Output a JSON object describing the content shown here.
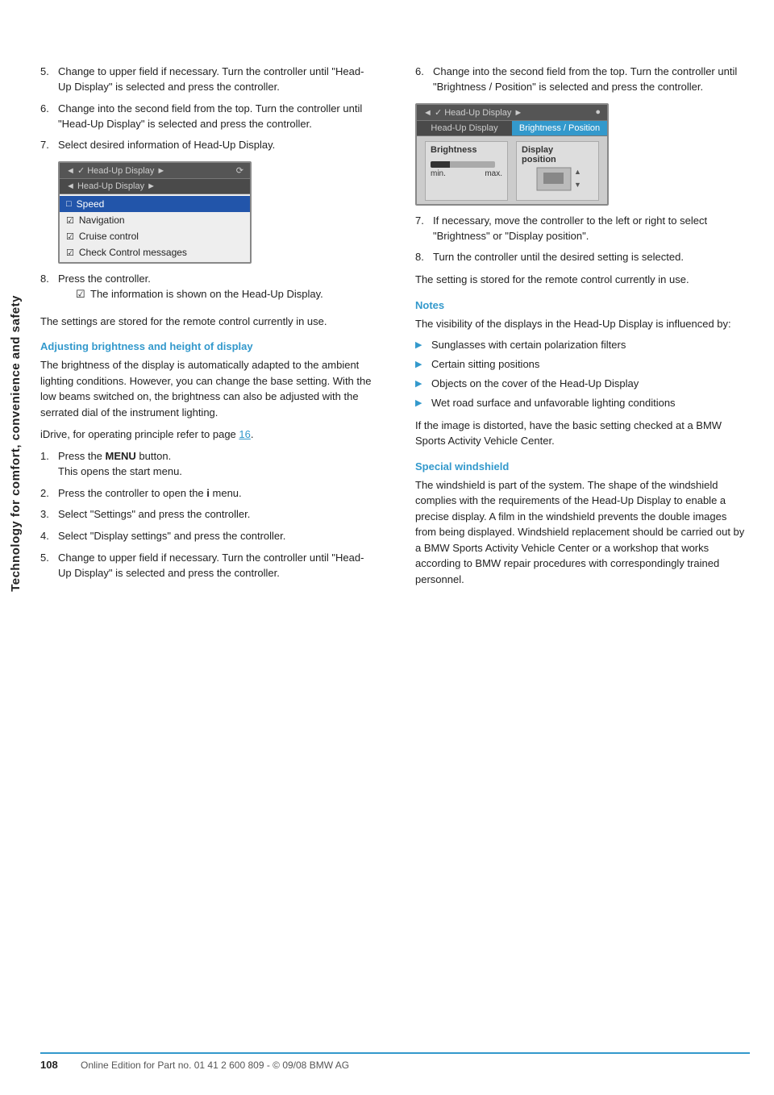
{
  "sidebar": {
    "label": "Technology for comfort, convenience and safety"
  },
  "left_col": {
    "steps_top": [
      {
        "num": "5.",
        "text": "Change to upper field if necessary. Turn the controller until \"Head-Up Display\" is selected and press the controller."
      },
      {
        "num": "6.",
        "text": "Change into the second field from the top. Turn the controller until \"Head-Up Display\" is selected and press the controller."
      },
      {
        "num": "7.",
        "text": "Select desired information of Head-Up Display."
      }
    ],
    "hud_ui_left": {
      "topbar_left": "◄ ✓ Head-Up Display ►",
      "navbar": "◄ Head-Up Display ►",
      "items": [
        {
          "icon": "□",
          "label": "Speed",
          "selected": true
        },
        {
          "icon": "☑",
          "label": "Navigation",
          "selected": false
        },
        {
          "icon": "☑",
          "label": "Cruise control",
          "selected": false
        },
        {
          "icon": "☑",
          "label": "Check Control messages",
          "selected": false
        }
      ]
    },
    "step8": {
      "num": "8.",
      "text": "Press the controller.",
      "substep": "The information is shown on the Head-Up Display."
    },
    "note_after_step8": "The settings are stored for the remote control currently in use.",
    "section_heading": "Adjusting brightness and height of display",
    "body1": "The brightness of the display is automatically adapted to the ambient lighting conditions. However, you can change the base setting. With the low beams switched on, the brightness can also be adjusted with the serrated dial of the instrument lighting.",
    "idrive_ref": "iDrive, for operating principle refer to page 16.",
    "steps_bottom": [
      {
        "num": "1.",
        "text": "Press the MENU button.\nThis opens the start menu."
      },
      {
        "num": "2.",
        "text": "Press the controller to open the i menu."
      },
      {
        "num": "3.",
        "text": "Select \"Settings\" and press the controller."
      },
      {
        "num": "4.",
        "text": "Select \"Display settings\" and press the controller."
      },
      {
        "num": "5.",
        "text": "Change to upper field if necessary. Turn the controller until \"Head-Up Display\" is selected and press the controller."
      }
    ]
  },
  "right_col": {
    "step6": {
      "num": "6.",
      "text": "Change into the second field from the top. Turn the controller until \"Brightness / Position\" is selected and press the controller."
    },
    "hud_ui_right": {
      "topbar": "◄ ✓ Head-Up Display ►",
      "tabs": [
        {
          "label": "Head-Up Display",
          "active": false
        },
        {
          "label": "Brightness / Position",
          "active": true
        }
      ],
      "cells": [
        {
          "label": "Brightness"
        },
        {
          "label": "Display\nposition"
        }
      ]
    },
    "step7": {
      "num": "7.",
      "text": "If necessary, move the controller to the left or right to select \"Brightness\" or \"Display position\"."
    },
    "step8": {
      "num": "8.",
      "text": "Turn the controller until the desired setting is selected."
    },
    "note_stored": "The setting is stored for the remote control currently in use.",
    "notes_heading": "Notes",
    "notes_intro": "The visibility of the displays in the Head-Up Display is influenced by:",
    "notes_list": [
      "Sunglasses with certain polarization filters",
      "Certain sitting positions",
      "Objects on the cover of the Head-Up Display",
      "Wet road surface and unfavorable lighting conditions"
    ],
    "distorted_note": "If the image is distorted, have the basic setting checked at a BMW Sports Activity Vehicle Center.",
    "special_heading": "Special windshield",
    "special_text": "The windshield is part of the system. The shape of the windshield complies with the requirements of the Head-Up Display to enable a precise display. A film in the windshield prevents the double images from being displayed. Windshield replacement should be carried out by a BMW Sports Activity Vehicle Center or a workshop that works according to BMW repair procedures with correspondingly trained personnel."
  },
  "footer": {
    "page_num": "108",
    "text": "Online Edition for Part no. 01 41 2 600 809 - © 09/08 BMW AG"
  }
}
